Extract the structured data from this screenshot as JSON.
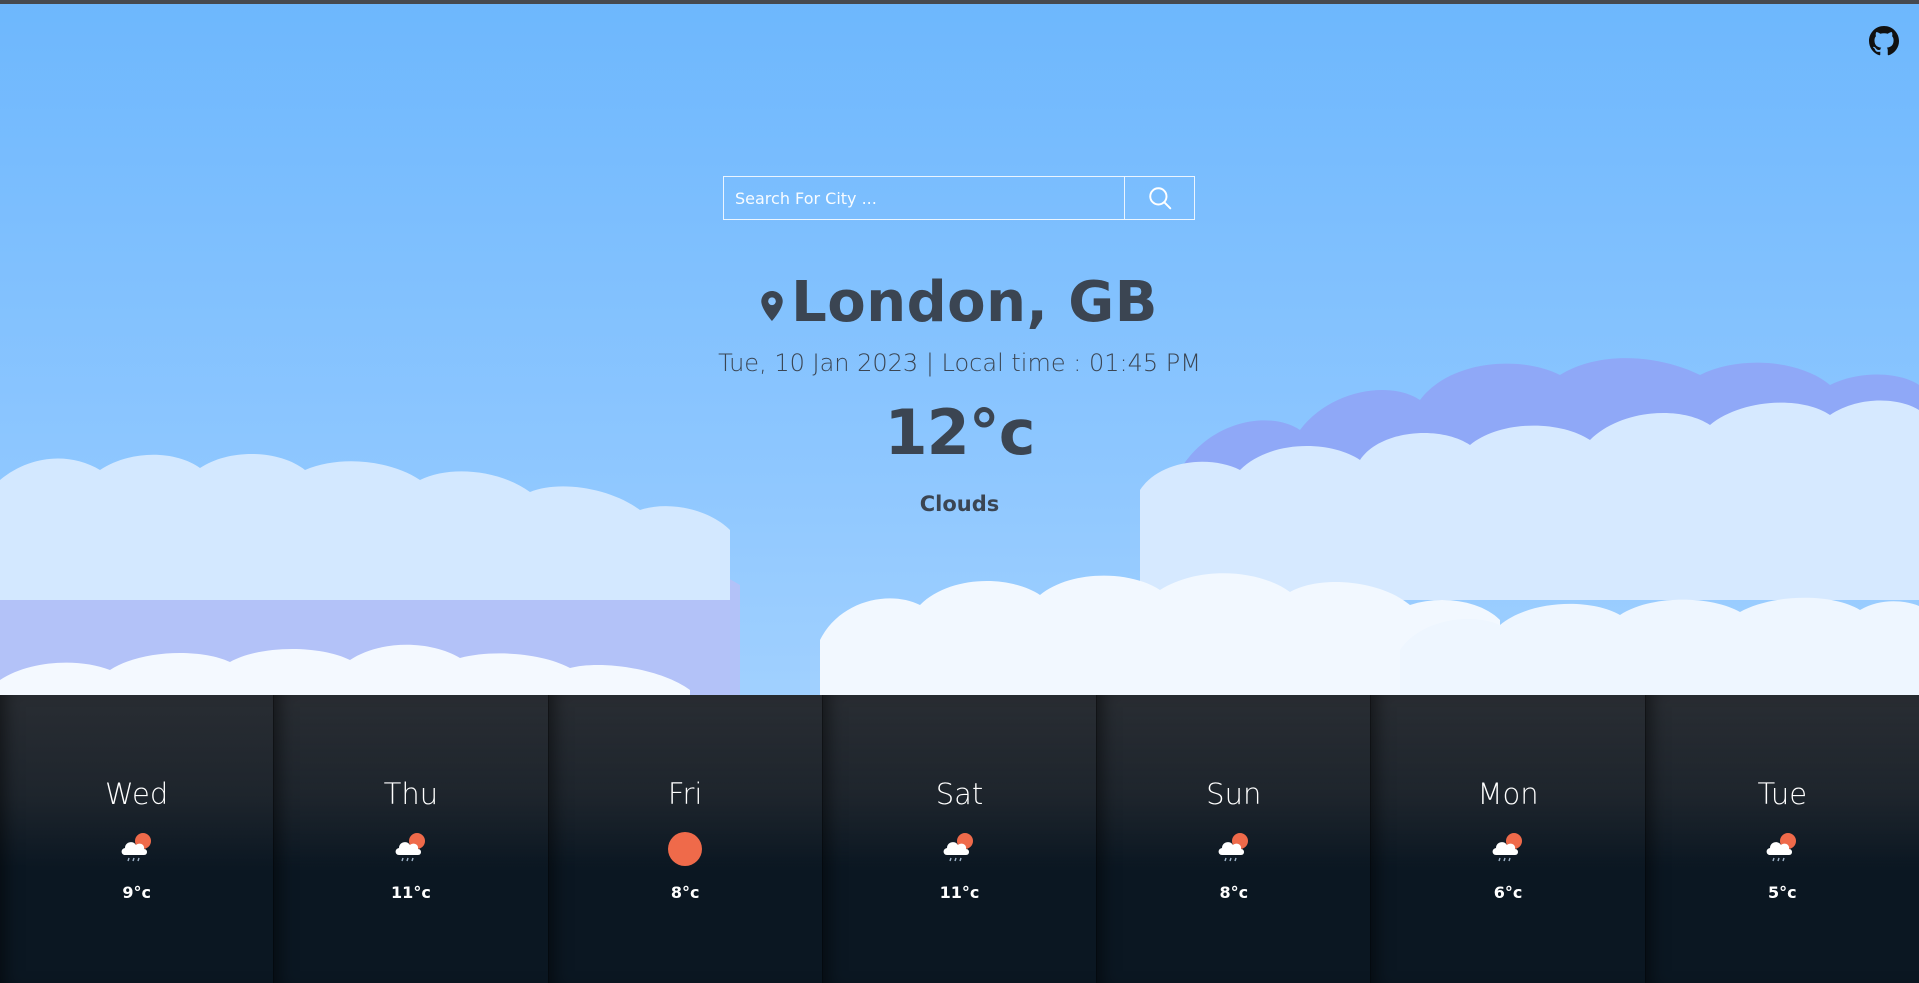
{
  "search": {
    "placeholder": "Search For City ..."
  },
  "current": {
    "city": "London, GB",
    "datetime": "Tue, 10 Jan 2023 | Local time : 01:45 PM",
    "temperature": "12°c",
    "condition": "Clouds"
  },
  "forecast": [
    {
      "day": "Wed",
      "temp": "9°c",
      "icon": "cloud-sun-rain-icon"
    },
    {
      "day": "Thu",
      "temp": "11°c",
      "icon": "cloud-sun-rain-icon"
    },
    {
      "day": "Fri",
      "temp": "8°c",
      "icon": "sun-icon"
    },
    {
      "day": "Sat",
      "temp": "11°c",
      "icon": "cloud-sun-rain-icon"
    },
    {
      "day": "Sun",
      "temp": "8°c",
      "icon": "cloud-sun-rain-icon"
    },
    {
      "day": "Mon",
      "temp": "6°c",
      "icon": "cloud-sun-rain-icon"
    },
    {
      "day": "Tue",
      "temp": "5°c",
      "icon": "cloud-sun-rain-icon"
    }
  ],
  "colors": {
    "sky": "#6db7fd",
    "text": "#3b4552",
    "sun": "#ef6a4a",
    "forecast_bg": "#2d3035"
  }
}
